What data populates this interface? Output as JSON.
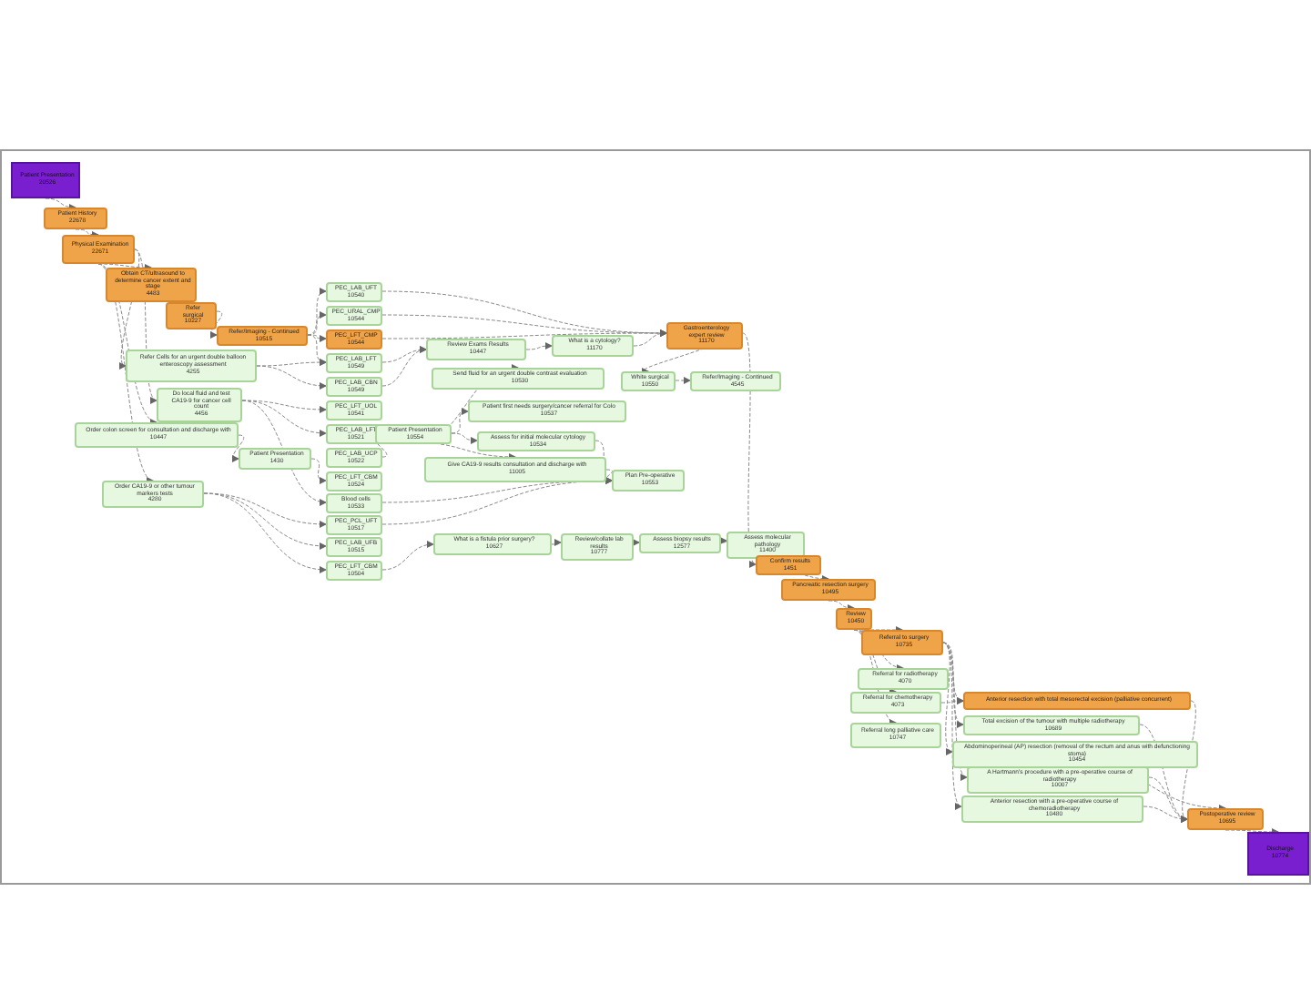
{
  "diagram": {
    "nodes": [
      {
        "kind": "start",
        "label": "Patient Presentation",
        "code": "20526"
      },
      {
        "kind": "key",
        "label": "Patient History",
        "code": "22678"
      },
      {
        "kind": "key",
        "label": "Physical Examination",
        "code": "22671"
      },
      {
        "kind": "key",
        "label": "Obtain CT/ultrasound to determine cancer extent and stage",
        "code": "4483"
      },
      {
        "kind": "key",
        "label": "Refer surgical",
        "code": "10227"
      },
      {
        "kind": "key",
        "label": "Refer/Imaging - Continued",
        "code": "10515"
      },
      {
        "kind": "option",
        "label": "PEC_LAB_UFT",
        "code": "10540"
      },
      {
        "kind": "option",
        "label": "PEC_URAL_CMP",
        "code": "10544"
      },
      {
        "kind": "key",
        "label": "PEC_LFT_CMP",
        "code": "10544"
      },
      {
        "kind": "option",
        "label": "PEC_LAB_LFT",
        "code": "10549"
      },
      {
        "kind": "option",
        "label": "PEC_LAB_CBN",
        "code": "10549"
      },
      {
        "kind": "option",
        "label": "PEC_LFT_UOL",
        "code": "10541"
      },
      {
        "kind": "option",
        "label": "PEC_LAB_LFT",
        "code": "10521"
      },
      {
        "kind": "option",
        "label": "PEC_LAB_UCP",
        "code": "10522"
      },
      {
        "kind": "option",
        "label": "PEC_LFT_CBM",
        "code": "10524"
      },
      {
        "kind": "option",
        "label": "Blood cells",
        "code": "10533"
      },
      {
        "kind": "option",
        "label": "PEC_PCL_UFT",
        "code": "10517"
      },
      {
        "kind": "option",
        "label": "PEC_LAB_UFB",
        "code": "10515"
      },
      {
        "kind": "option",
        "label": "PEC_LFT_CBM",
        "code": "10504"
      },
      {
        "kind": "option",
        "label": "Refer Cells for an urgent double balloon enteroscopy assessment",
        "code": "4255"
      },
      {
        "kind": "option",
        "label": "Do local fluid and test CA19-9 for cancer cell count",
        "code": "4456"
      },
      {
        "kind": "option",
        "label": "Order colon screen for consultation and discharge with",
        "code": "10447"
      },
      {
        "kind": "option",
        "label": "Patient Presentation",
        "code": "1430"
      },
      {
        "kind": "option",
        "label": "Order CA19-9 or other tumour markers tests",
        "code": "4280"
      },
      {
        "kind": "option",
        "label": "Review Exams Results",
        "code": "10447"
      },
      {
        "kind": "option",
        "label": "What is a cytology?",
        "code": "11170"
      },
      {
        "kind": "key",
        "label": "Gastroenterology expert review",
        "code": "11170"
      },
      {
        "kind": "option",
        "label": "Send fluid for an urgent double contrast evaluation",
        "code": "10530"
      },
      {
        "kind": "option",
        "label": "White surgical",
        "code": "10550"
      },
      {
        "kind": "option",
        "label": "Refer/Imaging - Continued",
        "code": "4545"
      },
      {
        "kind": "option",
        "label": "Patient first needs surgery/cancer referral for Colo",
        "code": "10537"
      },
      {
        "kind": "option",
        "label": "Patient Presentation",
        "code": "10554"
      },
      {
        "kind": "option",
        "label": "Assess for initial molecular cytology",
        "code": "10534"
      },
      {
        "kind": "option",
        "label": "Give CA19-9 results consultation and discharge with",
        "code": "11005"
      },
      {
        "kind": "option",
        "label": "Plan Pre-operative",
        "code": "10553"
      },
      {
        "kind": "option",
        "label": "What is a fistula prior surgery?",
        "code": "10627"
      },
      {
        "kind": "option",
        "label": "Review/collate lab results",
        "code": "10777"
      },
      {
        "kind": "option",
        "label": "Assess biopsy results",
        "code": "12577"
      },
      {
        "kind": "option",
        "label": "Assess molecular pathology",
        "code": "11400"
      },
      {
        "kind": "key",
        "label": "Confirm results",
        "code": "1451"
      },
      {
        "kind": "key",
        "label": "Pancreatic resection surgery",
        "code": "10495"
      },
      {
        "kind": "key",
        "label": "Review",
        "code": "10450"
      },
      {
        "kind": "key",
        "label": "Referral to surgery",
        "code": "10735"
      },
      {
        "kind": "option",
        "label": "Referral for radiotherapy",
        "code": "4070"
      },
      {
        "kind": "option",
        "label": "Referral for chemotherapy",
        "code": "4073"
      },
      {
        "kind": "option",
        "label": "Referral long palliative care",
        "code": "10747"
      },
      {
        "kind": "key",
        "label": "Anterior resection with total mesorectal excision (palliative concurrent)"
      },
      {
        "kind": "option",
        "label": "Total excision of the tumour with multiple radiotherapy",
        "code": "10689"
      },
      {
        "kind": "option",
        "label": "Abdominoperineal (AP) resection (removal of the rectum and anus with defunctioning stoma)",
        "code": "10454"
      },
      {
        "kind": "option",
        "label": "A Hartmann's procedure with a pre-operative course of radiotherapy",
        "code": "10007"
      },
      {
        "kind": "option",
        "label": "Anterior resection with a pre-operative course of chemoradiotherapy",
        "code": "10480"
      },
      {
        "kind": "key",
        "label": "Postoperative review",
        "code": "10695"
      },
      {
        "kind": "end",
        "label": "Discharge",
        "code": "10774"
      }
    ]
  }
}
